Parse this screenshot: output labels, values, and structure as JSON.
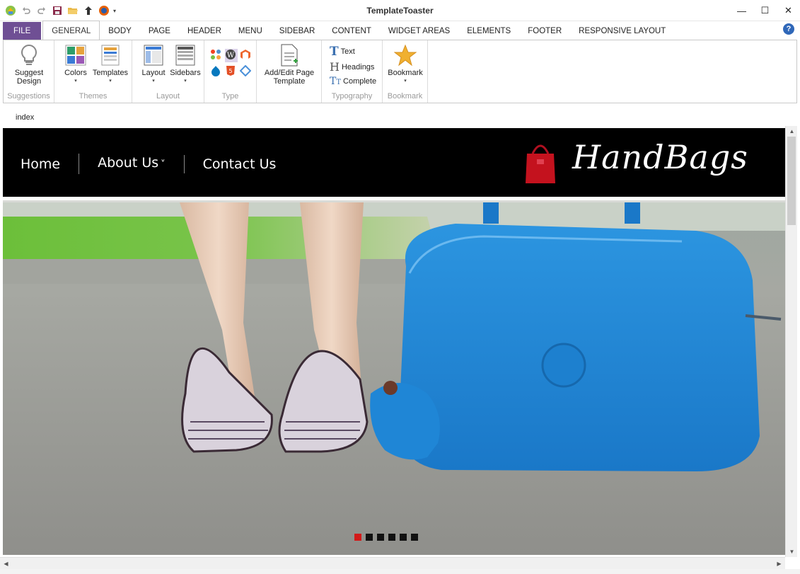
{
  "app": {
    "title": "TemplateToaster"
  },
  "quick_access": [
    "app-logo-icon",
    "undo-icon",
    "redo-icon",
    "save-icon",
    "open-folder-icon",
    "upload-icon",
    "firefox-icon"
  ],
  "window_controls": {
    "minimize": "—",
    "maximize": "☐",
    "close": "✕"
  },
  "tabs": [
    {
      "label": "FILE"
    },
    {
      "label": "GENERAL"
    },
    {
      "label": "BODY"
    },
    {
      "label": "PAGE"
    },
    {
      "label": "HEADER"
    },
    {
      "label": "MENU"
    },
    {
      "label": "SIDEBAR"
    },
    {
      "label": "CONTENT"
    },
    {
      "label": "WIDGET AREAS"
    },
    {
      "label": "ELEMENTS"
    },
    {
      "label": "FOOTER"
    },
    {
      "label": "RESPONSIVE LAYOUT"
    }
  ],
  "active_tab": "GENERAL",
  "help_label": "?",
  "ribbon": {
    "suggestions": {
      "label": "Suggestions",
      "btn_line1": "Suggest",
      "btn_line2": "Design"
    },
    "themes": {
      "label": "Themes",
      "colors": "Colors",
      "templates": "Templates"
    },
    "layout": {
      "label": "Layout",
      "layout": "Layout",
      "sidebars": "Sidebars"
    },
    "type": {
      "label": "Type"
    },
    "page_template": {
      "line1": "Add/Edit Page",
      "line2": "Template"
    },
    "typography": {
      "label": "Typography",
      "text": "Text",
      "headings": "Headings",
      "complete": "Complete"
    },
    "bookmark": {
      "label": "Bookmark",
      "btn": "Bookmark"
    }
  },
  "document_tab": "index",
  "site": {
    "nav": [
      "Home",
      "About Us",
      "Contact Us"
    ],
    "about_caret": "⌄",
    "logo_text": "HandBags",
    "slider_dots": 6,
    "active_dot": 0
  },
  "colors": {
    "file_tab": "#6f4f94",
    "header_bg": "#000000",
    "active_dot": "#d21a1a",
    "bag_blue": "#1f86d6"
  }
}
